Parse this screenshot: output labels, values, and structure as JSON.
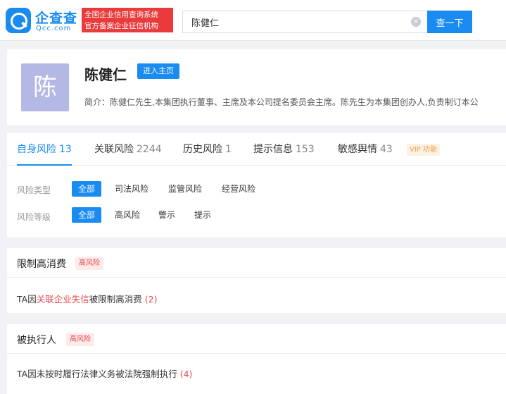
{
  "header": {
    "logo_cn": "企查查",
    "logo_en": "Qcc.com",
    "slogan_line1": "全国企业信用查询系统",
    "slogan_line2": "官方备案企业征信机构",
    "search_value": "陈健仁",
    "clear_glyph": "×",
    "search_button": "查一下"
  },
  "profile": {
    "avatar_char": "陈",
    "name": "陈健仁",
    "home_button": "进入主页",
    "intro": "简介：陈健仁先生,本集团执行董事、主席及本公司提名委员会主席。陈先生为本集团创办人,负责制订本公"
  },
  "tabs": [
    {
      "label": "自身风险",
      "count": "13"
    },
    {
      "label": "关联风险",
      "count": "2244"
    },
    {
      "label": "历史风险",
      "count": "1"
    },
    {
      "label": "提示信息",
      "count": "153"
    },
    {
      "label": "敏感舆情",
      "count": "43"
    }
  ],
  "vip_badge": "VIP 功能",
  "filters": {
    "type_label": "风险类型",
    "types": [
      "全部",
      "司法风险",
      "监管风险",
      "经营风险"
    ],
    "level_label": "风险等级",
    "levels": [
      "全部",
      "高风险",
      "警示",
      "提示"
    ]
  },
  "sections": [
    {
      "title": "限制高消费",
      "badge": "高风险",
      "line_prefix": "TA因",
      "line_highlight": "关联企业失信",
      "line_suffix": "被限制高消费",
      "count": "(2)"
    },
    {
      "title": "被执行人",
      "badge": "高风险",
      "line_prefix": "TA因未按时履行法律义务被法院强制执行",
      "count": "(4)"
    }
  ],
  "colors": {
    "brand": "#1a8bf0",
    "danger": "#e5484d",
    "slogan_bg": "#e93b3b",
    "avatar_bg": "#b4b8e4"
  }
}
